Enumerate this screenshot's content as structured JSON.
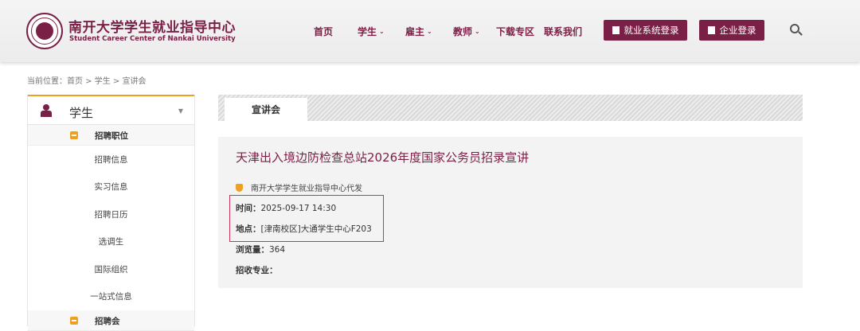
{
  "header": {
    "logo_cn": "南开大学学生就业指导中心",
    "logo_en": "Student Career Center of Nankai University",
    "nav": [
      {
        "label": "首页",
        "has_dropdown": false
      },
      {
        "label": "学生",
        "has_dropdown": true
      },
      {
        "label": "雇主",
        "has_dropdown": true
      },
      {
        "label": "教师",
        "has_dropdown": true
      },
      {
        "label": "下载专区",
        "has_dropdown": false
      },
      {
        "label": "联系我们",
        "has_dropdown": false
      }
    ],
    "student_login": "就业系统登录",
    "company_login": "企业登录",
    "accent_color": "#7a1f45"
  },
  "breadcrumb": "当前位置：首页 > 学生 > 宣讲会",
  "sidebar": {
    "title": "学生",
    "category1": "招聘职位",
    "items": [
      "招聘信息",
      "实习信息",
      "招聘日历",
      "选调生",
      "国际组织",
      "一站式信息"
    ],
    "category2": "招聘会"
  },
  "tab_label": "宣讲会",
  "event": {
    "title": "天津出入境边防检查总站2026年度国家公务员招录宣讲",
    "publisher": "南开大学学生就业指导中心代发",
    "time_label": "时间：",
    "time_value": "2025-09-17 14:30",
    "location_label": "地点：",
    "location_value": "[津南校区]大通学生中心F203",
    "views_label": "浏览量：",
    "views_value": "364",
    "majors_label": "招收专业：",
    "majors_value": ""
  }
}
